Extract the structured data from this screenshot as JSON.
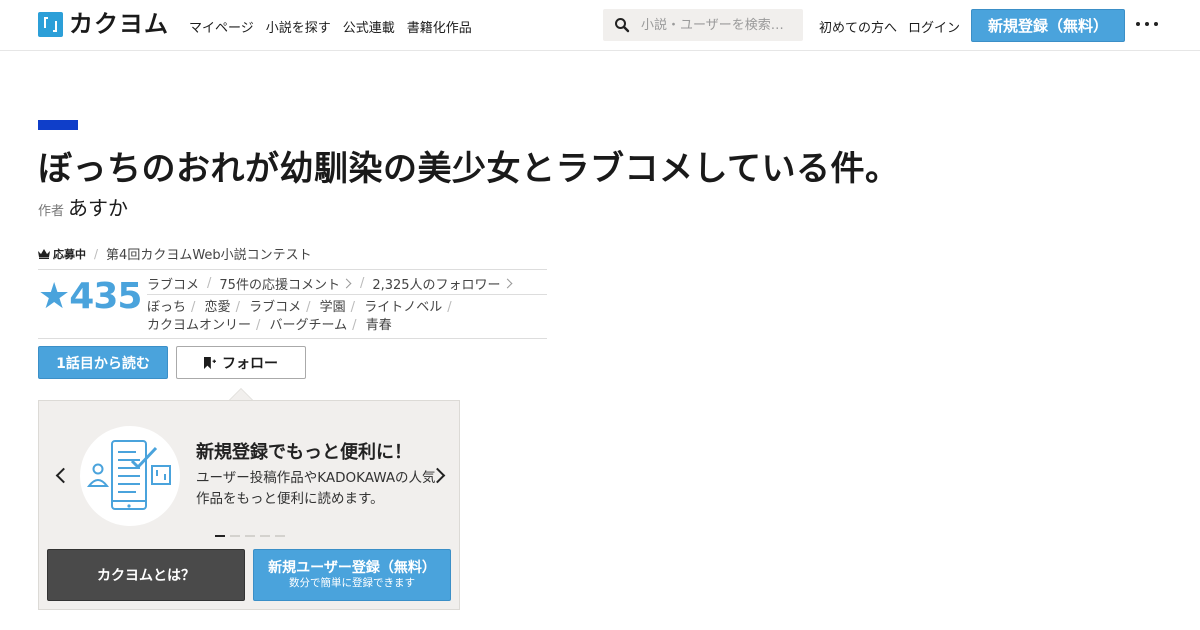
{
  "header": {
    "logo_text": "カクヨム",
    "nav": [
      "マイページ",
      "小説を探す",
      "公式連載",
      "書籍化作品"
    ],
    "search_placeholder": "小説・ユーザーを検索…",
    "first_time": "初めての方へ",
    "login": "ログイン",
    "signup": "新規登録（無料）"
  },
  "work": {
    "title": "ぼっちのおれが幼馴染の美少女とラブコメしている件。",
    "author_label": "作者",
    "author": "あすか",
    "contest_status": "応募中",
    "contest_name": "第4回カクヨムWeb小説コンテスト",
    "stars": "★435",
    "genre": "ラブコメ",
    "comments": "75件の応援コメント",
    "followers": "2,325人のフォロワー",
    "tags": [
      "ぼっち",
      "恋愛",
      "ラブコメ",
      "学園",
      "ライトノベル",
      "カクヨムオンリー",
      "バーグチーム",
      "青春"
    ],
    "read_button": "1話目から読む",
    "follow_button": "フォロー"
  },
  "promo": {
    "title": "新規登録でもっと便利に！",
    "text": "ユーザー投稿作品やKADOKAWAの人気作品をもっと便利に読めます。",
    "slide_total": 5,
    "slide_active": 1,
    "about_button": "カクヨムとは？",
    "register_button": "新規ユーザー登録（無料）",
    "register_sub": "数分で簡単に登録できます"
  },
  "colors": {
    "accent": "#4aa3dc",
    "title_bar": "#0f3ec9",
    "promo_bg": "#f1efed"
  }
}
